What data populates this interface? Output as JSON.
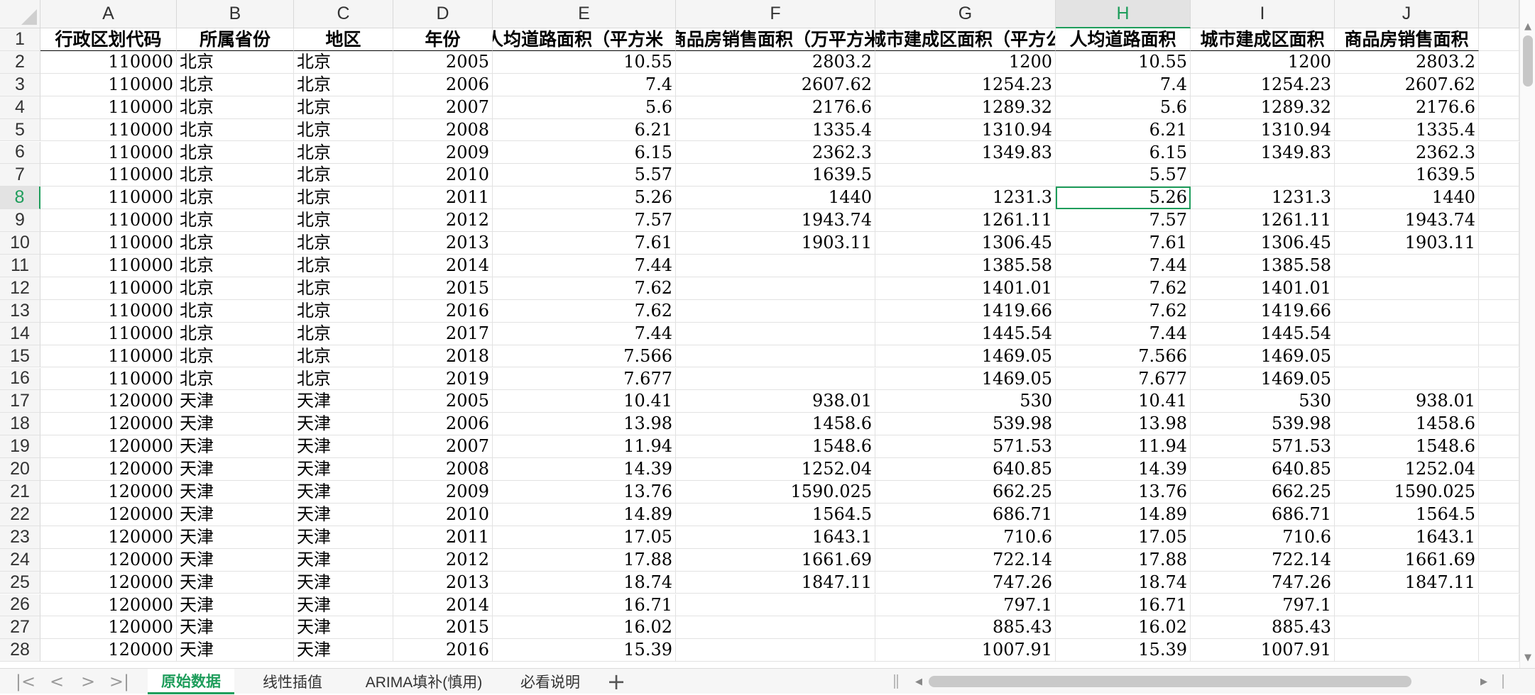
{
  "columns": [
    "A",
    "B",
    "C",
    "D",
    "E",
    "F",
    "G",
    "H",
    "I",
    "J"
  ],
  "selected_column": "H",
  "selected_row": 8,
  "header_row": [
    "行政区划代码",
    "所属省份",
    "地区",
    "年份",
    "人均道路面积（平方米",
    "商品房销售面积（万平方米",
    "城市建成区面积（平方公里",
    "人均道路面积",
    "城市建成区面积",
    "商品房销售面积"
  ],
  "rows": [
    [
      "110000",
      "北京",
      "北京",
      "2005",
      "10.55",
      "2803.2",
      "1200",
      "10.55",
      "1200",
      "2803.2"
    ],
    [
      "110000",
      "北京",
      "北京",
      "2006",
      "7.4",
      "2607.62",
      "1254.23",
      "7.4",
      "1254.23",
      "2607.62"
    ],
    [
      "110000",
      "北京",
      "北京",
      "2007",
      "5.6",
      "2176.6",
      "1289.32",
      "5.6",
      "1289.32",
      "2176.6"
    ],
    [
      "110000",
      "北京",
      "北京",
      "2008",
      "6.21",
      "1335.4",
      "1310.94",
      "6.21",
      "1310.94",
      "1335.4"
    ],
    [
      "110000",
      "北京",
      "北京",
      "2009",
      "6.15",
      "2362.3",
      "1349.83",
      "6.15",
      "1349.83",
      "2362.3"
    ],
    [
      "110000",
      "北京",
      "北京",
      "2010",
      "5.57",
      "1639.5",
      "",
      "5.57",
      "",
      "1639.5"
    ],
    [
      "110000",
      "北京",
      "北京",
      "2011",
      "5.26",
      "1440",
      "1231.3",
      "5.26",
      "1231.3",
      "1440"
    ],
    [
      "110000",
      "北京",
      "北京",
      "2012",
      "7.57",
      "1943.74",
      "1261.11",
      "7.57",
      "1261.11",
      "1943.74"
    ],
    [
      "110000",
      "北京",
      "北京",
      "2013",
      "7.61",
      "1903.11",
      "1306.45",
      "7.61",
      "1306.45",
      "1903.11"
    ],
    [
      "110000",
      "北京",
      "北京",
      "2014",
      "7.44",
      "",
      "1385.58",
      "7.44",
      "1385.58",
      ""
    ],
    [
      "110000",
      "北京",
      "北京",
      "2015",
      "7.62",
      "",
      "1401.01",
      "7.62",
      "1401.01",
      ""
    ],
    [
      "110000",
      "北京",
      "北京",
      "2016",
      "7.62",
      "",
      "1419.66",
      "7.62",
      "1419.66",
      ""
    ],
    [
      "110000",
      "北京",
      "北京",
      "2017",
      "7.44",
      "",
      "1445.54",
      "7.44",
      "1445.54",
      ""
    ],
    [
      "110000",
      "北京",
      "北京",
      "2018",
      "7.566",
      "",
      "1469.05",
      "7.566",
      "1469.05",
      ""
    ],
    [
      "110000",
      "北京",
      "北京",
      "2019",
      "7.677",
      "",
      "1469.05",
      "7.677",
      "1469.05",
      ""
    ],
    [
      "120000",
      "天津",
      "天津",
      "2005",
      "10.41",
      "938.01",
      "530",
      "10.41",
      "530",
      "938.01"
    ],
    [
      "120000",
      "天津",
      "天津",
      "2006",
      "13.98",
      "1458.6",
      "539.98",
      "13.98",
      "539.98",
      "1458.6"
    ],
    [
      "120000",
      "天津",
      "天津",
      "2007",
      "11.94",
      "1548.6",
      "571.53",
      "11.94",
      "571.53",
      "1548.6"
    ],
    [
      "120000",
      "天津",
      "天津",
      "2008",
      "14.39",
      "1252.04",
      "640.85",
      "14.39",
      "640.85",
      "1252.04"
    ],
    [
      "120000",
      "天津",
      "天津",
      "2009",
      "13.76",
      "1590.025",
      "662.25",
      "13.76",
      "662.25",
      "1590.025"
    ],
    [
      "120000",
      "天津",
      "天津",
      "2010",
      "14.89",
      "1564.5",
      "686.71",
      "14.89",
      "686.71",
      "1564.5"
    ],
    [
      "120000",
      "天津",
      "天津",
      "2011",
      "17.05",
      "1643.1",
      "710.6",
      "17.05",
      "710.6",
      "1643.1"
    ],
    [
      "120000",
      "天津",
      "天津",
      "2012",
      "17.88",
      "1661.69",
      "722.14",
      "17.88",
      "722.14",
      "1661.69"
    ],
    [
      "120000",
      "天津",
      "天津",
      "2013",
      "18.74",
      "1847.11",
      "747.26",
      "18.74",
      "747.26",
      "1847.11"
    ],
    [
      "120000",
      "天津",
      "天津",
      "2014",
      "16.71",
      "",
      "797.1",
      "16.71",
      "797.1",
      ""
    ],
    [
      "120000",
      "天津",
      "天津",
      "2015",
      "16.02",
      "",
      "885.43",
      "16.02",
      "885.43",
      ""
    ],
    [
      "120000",
      "天津",
      "天津",
      "2016",
      "15.39",
      "",
      "1007.91",
      "15.39",
      "1007.91",
      ""
    ]
  ],
  "sheet_tabs": [
    "原始数据",
    "线性插值",
    "ARIMA填补(慎用)",
    "必看说明"
  ],
  "active_tab": "原始数据",
  "accent_color": "#1e9d5b",
  "nav_icons": [
    "first-sheet-icon",
    "prev-sheet-icon",
    "next-sheet-icon",
    "last-sheet-icon"
  ]
}
